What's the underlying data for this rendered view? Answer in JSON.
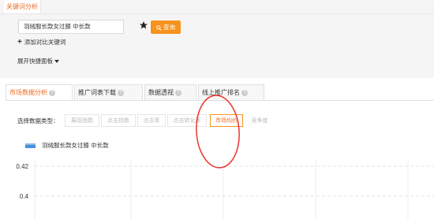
{
  "top": {
    "title": "关键词分析"
  },
  "keyword_panel": {
    "input_value": "羽绒服长款女过膝 中长款",
    "query_label": "查询",
    "add_compare_label": "添加对比关键词",
    "expand_label": "展开快捷面板"
  },
  "tabs": [
    {
      "label": "市场数据分析",
      "active": true
    },
    {
      "label": "推广词表下载",
      "active": false
    },
    {
      "label": "数据透视",
      "active": false
    },
    {
      "label": "线上推广排名",
      "active": false
    }
  ],
  "data_type": {
    "label": "选择数据类型：",
    "options": [
      {
        "label": "展现指数",
        "selected": false
      },
      {
        "label": "点击指数",
        "selected": false
      },
      {
        "label": "点击率",
        "selected": false
      },
      {
        "label": "点击转化率",
        "selected": false
      },
      {
        "label": "市场均价",
        "selected": true
      },
      {
        "label": "竞争度",
        "selected": false
      }
    ]
  },
  "colors": {
    "accent": "#f06b22",
    "button": "#f7931e",
    "annotation": "#e8352d",
    "series": "#4a90d9"
  },
  "chart_data": {
    "type": "line",
    "legend": [
      "羽绒服长款女过膝 中长款"
    ],
    "y_ticks": [
      "0.42",
      "0.4"
    ],
    "ylim": [
      0.39,
      0.425
    ],
    "grid": true,
    "series": [
      {
        "name": "羽绒服长款女过膝 中长款",
        "values": []
      }
    ]
  }
}
